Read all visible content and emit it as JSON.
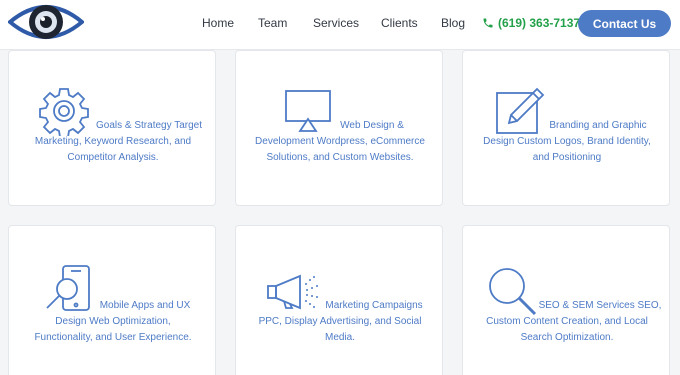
{
  "header": {
    "nav": [
      "Home",
      "Team",
      "Services",
      "Clients",
      "Blog"
    ],
    "phone": "(619) 363-7137",
    "contact_label": "Contact Us"
  },
  "services": [
    {
      "icon": "gear-icon",
      "lines": [
        "Goals & Strategy Target",
        "Marketing, Keyword Research, and",
        "Competitor Analysis."
      ]
    },
    {
      "icon": "monitor-icon",
      "lines": [
        "Web Design &",
        "Development Wordpress, eCommerce",
        "Solutions, and Custom Websites."
      ]
    },
    {
      "icon": "pencil-edit-icon",
      "lines": [
        "Branding and Graphic",
        "Design Custom Logos, Brand Identity,",
        "and Positioning"
      ]
    },
    {
      "icon": "mobile-search-icon",
      "lines": [
        "Mobile Apps and UX",
        "Design Web Optimization,",
        "Functionality, and User Experience."
      ]
    },
    {
      "icon": "megaphone-icon",
      "lines": [
        "Marketing Campaigns",
        "PPC, Display Advertising, and Social",
        "Media."
      ]
    },
    {
      "icon": "magnifier-icon",
      "lines": [
        "SEO & SEM Services SEO,",
        "Custom Content Creation, and Local",
        "Search Optimization."
      ]
    }
  ],
  "colors": {
    "accent": "#4e7bc6",
    "phone": "#23a04a",
    "card_border": "#e3e6ea",
    "background": "#f4f5f7"
  }
}
